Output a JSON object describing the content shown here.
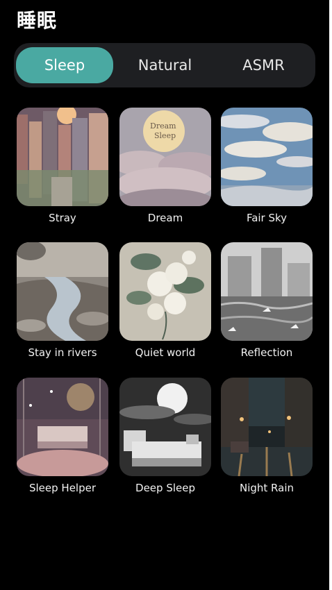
{
  "page_title": "睡眠",
  "tabs": [
    {
      "label": "Sleep",
      "active": true
    },
    {
      "label": "Natural",
      "active": false
    },
    {
      "label": "ASMR",
      "active": false
    }
  ],
  "accent_color": "#4aa9a2",
  "cards": [
    {
      "label": "Stray"
    },
    {
      "label": "Dream",
      "art_text": "Dream Sleep"
    },
    {
      "label": "Fair Sky"
    },
    {
      "label": "Stay in rivers"
    },
    {
      "label": "Quiet world"
    },
    {
      "label": "Reflection"
    },
    {
      "label": "Sleep Helper"
    },
    {
      "label": "Deep Sleep"
    },
    {
      "label": "Night Rain"
    }
  ]
}
